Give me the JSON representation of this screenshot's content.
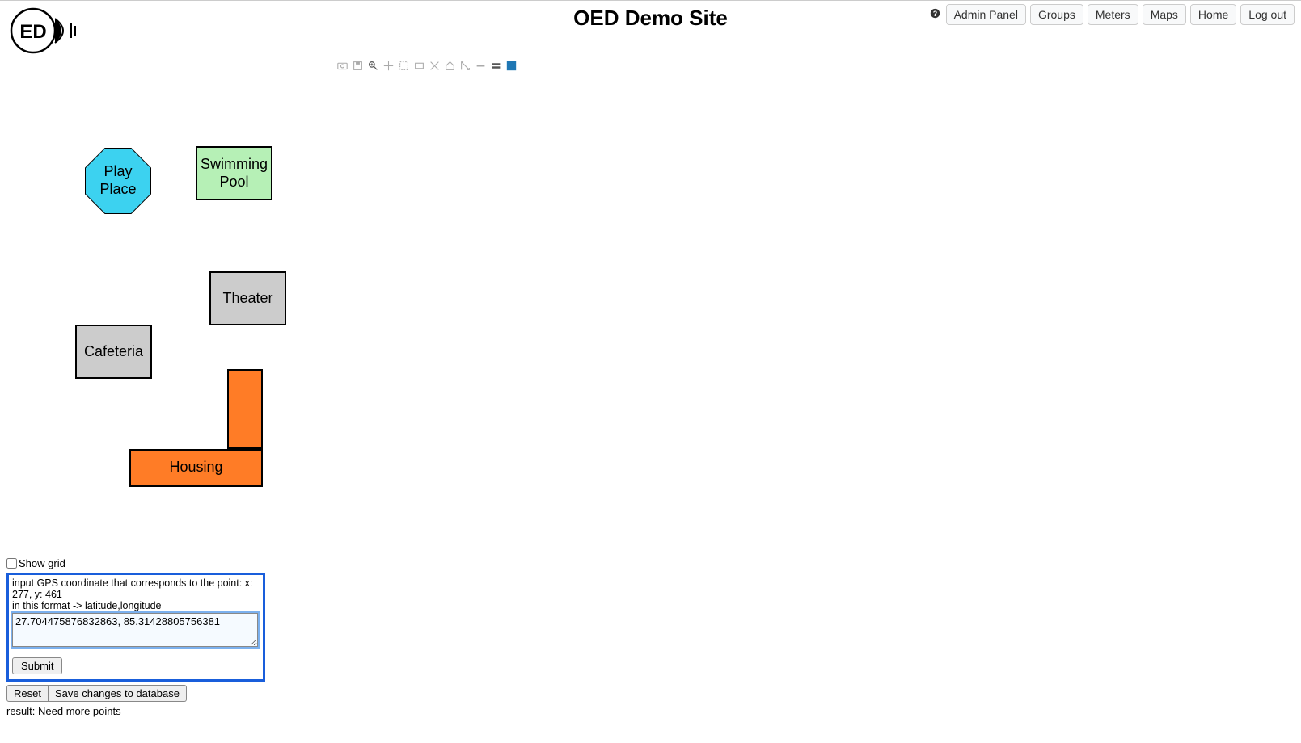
{
  "header": {
    "title": "OED Demo Site"
  },
  "nav": {
    "admin_panel": "Admin Panel",
    "groups": "Groups",
    "meters": "Meters",
    "maps": "Maps",
    "home": "Home",
    "logout": "Log out"
  },
  "shapes": {
    "play_place_l1": "Play",
    "play_place_l2": "Place",
    "swimming_pool_l1": "Swimming",
    "swimming_pool_l2": "Pool",
    "theater": "Theater",
    "cafeteria": "Cafeteria",
    "housing": "Housing"
  },
  "controls": {
    "show_grid_label": "Show grid",
    "gps_prompt_line1": "input GPS coordinate that corresponds to the point: x: 277, y: 461",
    "gps_prompt_line2": "in this format -> latitude,longitude",
    "gps_input_value": "27.704475876832863, 85.31428805756381",
    "submit_label": "Submit",
    "reset_label": "Reset",
    "save_label": "Save changes to database",
    "result_text": "result: Need more points"
  }
}
